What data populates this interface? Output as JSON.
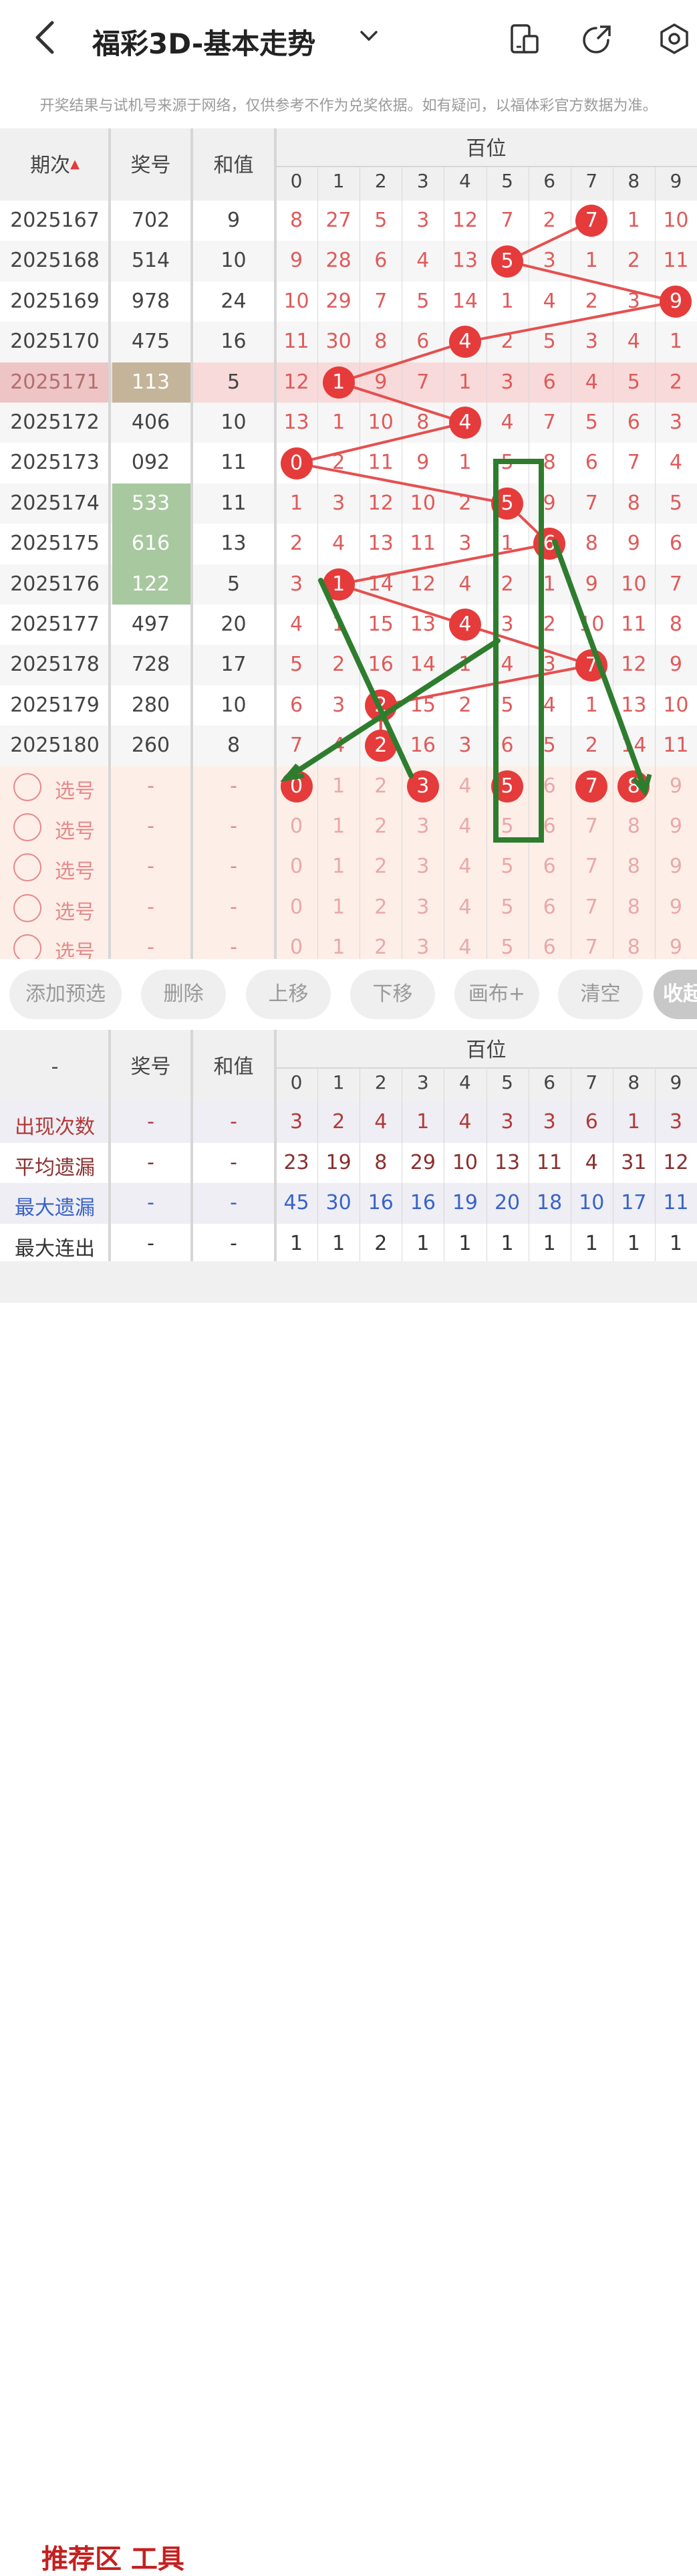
{
  "header": {
    "back_icon": "chevron-left-icon",
    "title": "福彩3D-基本走势",
    "dropdown_icon": "chevron-down-icon",
    "icons": [
      "phone-card-icon",
      "share-arrow-icon",
      "settings-hex-icon"
    ]
  },
  "notice": "开奖结果与试机号来源于网络，仅供参考不作为兑奖依据。如有疑问，以福体彩官方数据为准。",
  "table": {
    "col_period": "期次",
    "col_number": "奖号",
    "col_sum": "和值",
    "group_label": "百位",
    "digits": [
      "0",
      "1",
      "2",
      "3",
      "4",
      "5",
      "6",
      "7",
      "8",
      "9"
    ],
    "rows": [
      {
        "period": "2025167",
        "number": "702",
        "sum": "9",
        "vals": [
          "8",
          "27",
          "5",
          "3",
          "12",
          "7",
          "2",
          "7",
          "1",
          "10"
        ],
        "hit": 7
      },
      {
        "period": "2025168",
        "number": "514",
        "sum": "10",
        "vals": [
          "9",
          "28",
          "6",
          "4",
          "13",
          "5",
          "3",
          "1",
          "2",
          "11"
        ],
        "hit": 5
      },
      {
        "period": "2025169",
        "number": "978",
        "sum": "24",
        "vals": [
          "10",
          "29",
          "7",
          "5",
          "14",
          "1",
          "4",
          "2",
          "3",
          "9"
        ],
        "hit": 9
      },
      {
        "period": "2025170",
        "number": "475",
        "sum": "16",
        "vals": [
          "11",
          "30",
          "8",
          "6",
          "4",
          "2",
          "5",
          "3",
          "4",
          "1"
        ],
        "hit": 4
      },
      {
        "period": "2025171",
        "number": "113",
        "sum": "5",
        "vals": [
          "12",
          "1",
          "9",
          "7",
          "1",
          "3",
          "6",
          "4",
          "5",
          "2"
        ],
        "hit": 1
      },
      {
        "period": "2025172",
        "number": "406",
        "sum": "10",
        "vals": [
          "13",
          "1",
          "10",
          "8",
          "4",
          "4",
          "7",
          "5",
          "6",
          "3"
        ],
        "hit": 4
      },
      {
        "period": "2025173",
        "number": "092",
        "sum": "11",
        "vals": [
          "0",
          "2",
          "11",
          "9",
          "1",
          "5",
          "8",
          "6",
          "7",
          "4"
        ],
        "hit": 0
      },
      {
        "period": "2025174",
        "number": "533",
        "sum": "11",
        "vals": [
          "1",
          "3",
          "12",
          "10",
          "2",
          "5",
          "9",
          "7",
          "8",
          "5"
        ],
        "hit": 5
      },
      {
        "period": "2025175",
        "number": "616",
        "sum": "13",
        "vals": [
          "2",
          "4",
          "13",
          "11",
          "3",
          "1",
          "6",
          "8",
          "9",
          "6"
        ],
        "hit": 6
      },
      {
        "period": "2025176",
        "number": "122",
        "sum": "5",
        "vals": [
          "3",
          "1",
          "14",
          "12",
          "4",
          "2",
          "1",
          "9",
          "10",
          "7"
        ],
        "hit": 1
      },
      {
        "period": "2025177",
        "number": "497",
        "sum": "20",
        "vals": [
          "4",
          "1",
          "15",
          "13",
          "4",
          "3",
          "2",
          "10",
          "11",
          "8"
        ],
        "hit": 4
      },
      {
        "period": "2025178",
        "number": "728",
        "sum": "17",
        "vals": [
          "5",
          "2",
          "16",
          "14",
          "1",
          "4",
          "3",
          "7",
          "12",
          "9"
        ],
        "hit": 7
      },
      {
        "period": "2025179",
        "number": "280",
        "sum": "10",
        "vals": [
          "6",
          "3",
          "2",
          "15",
          "2",
          "5",
          "4",
          "1",
          "13",
          "10"
        ],
        "hit": 2
      },
      {
        "period": "2025180",
        "number": "260",
        "sum": "8",
        "vals": [
          "7",
          "4",
          "2",
          "16",
          "3",
          "6",
          "5",
          "2",
          "14",
          "11"
        ],
        "hit": 2
      }
    ],
    "pick_label": "选号",
    "pick_dash": "-",
    "pick_rows": 5,
    "first_pick_selected": [
      "0",
      "3",
      "5",
      "7",
      "8"
    ]
  },
  "buttons": [
    "添加预选",
    "删除",
    "上移",
    "下移",
    "画布+",
    "清空",
    "收起"
  ],
  "stats": {
    "col_first": "-",
    "col_number": "奖号",
    "col_sum": "和值",
    "group_label": "百位",
    "rows": [
      {
        "label": "出现次数",
        "num": "-",
        "sum": "-",
        "vals": [
          "3",
          "2",
          "4",
          "1",
          "4",
          "3",
          "3",
          "6",
          "1",
          "3"
        ],
        "color": "#b23a3a"
      },
      {
        "label": "平均遗漏",
        "num": "-",
        "sum": "-",
        "vals": [
          "23",
          "19",
          "8",
          "29",
          "10",
          "13",
          "11",
          "4",
          "31",
          "12"
        ],
        "color": "#8a2f2f"
      },
      {
        "label": "最大遗漏",
        "num": "-",
        "sum": "-",
        "vals": [
          "45",
          "30",
          "16",
          "16",
          "19",
          "20",
          "18",
          "10",
          "17",
          "11"
        ],
        "color": "#3a63c8"
      },
      {
        "label": "最大连出",
        "num": "-",
        "sum": "-",
        "vals": [
          "1",
          "1",
          "2",
          "1",
          "1",
          "1",
          "1",
          "1",
          "1",
          "1"
        ],
        "color": "#333333"
      }
    ]
  },
  "colors": {
    "accent_red": "#e53b3b",
    "highlight_row": "#f8dada",
    "green_cell": "#a8c8a0",
    "pick_bg": "#fdeee8",
    "annotation_green": "#2e7d2e"
  },
  "footer_peek": "推荐区 工具"
}
